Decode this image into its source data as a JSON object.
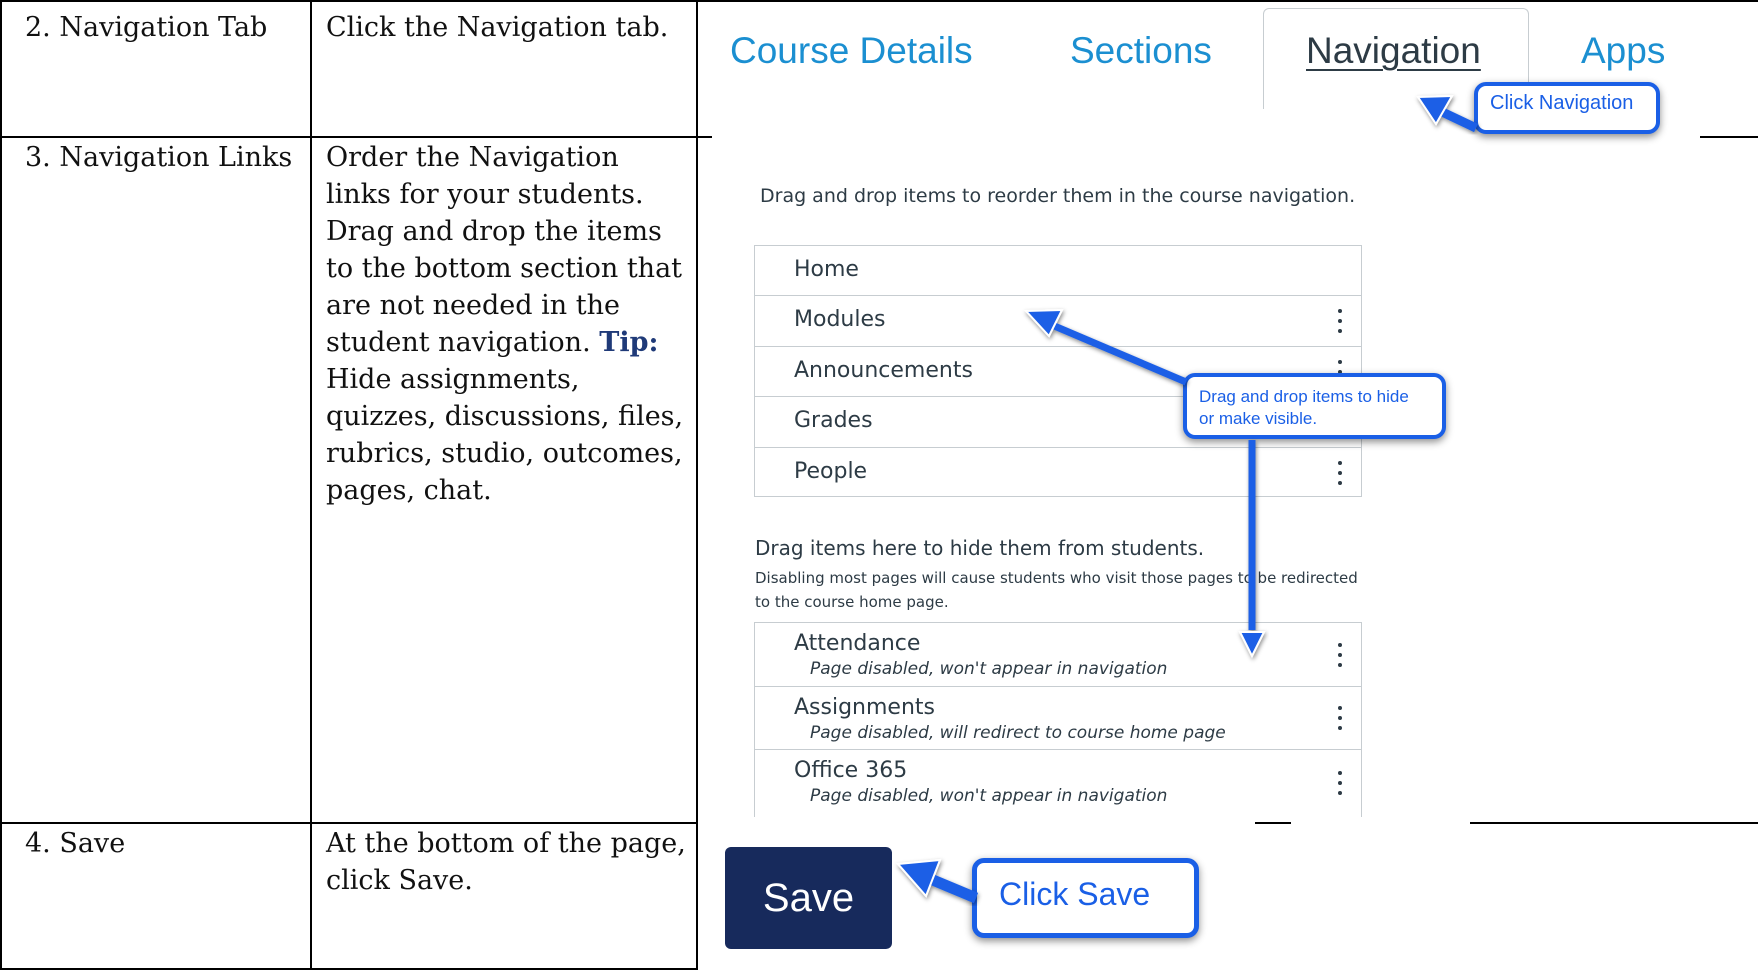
{
  "rows": [
    {
      "step": "2. Navigation Tab",
      "instruction": "Click the Navigation tab."
    },
    {
      "step": "3. Navigation Links",
      "instruction_lines": [
        "Order the Navigation",
        "links for your students.",
        "Drag and drop the items",
        "to the bottom section that",
        "are not needed in the",
        "student navigation. "
      ],
      "tip_label": "Tip:",
      "instruction_tail_lines": [
        "Hide assignments,",
        "quizzes, discussions, files,",
        "rubrics, studio, outcomes,",
        "pages, chat."
      ]
    },
    {
      "step": "4. Save",
      "instruction_lines": [
        "At the bottom of the page,",
        "click Save."
      ]
    }
  ],
  "tabs": [
    "Course Details",
    "Sections",
    "Navigation",
    "Apps"
  ],
  "active_tab": "Navigation",
  "callouts": {
    "navigation": "Click Navigation",
    "drag_line1": "Drag and drop items to hide",
    "drag_line2": "or make visible.",
    "save": "Click Save"
  },
  "navigation_page": {
    "instructions": "Drag and drop items to reorder them in the course navigation.",
    "enabled_items": [
      "Home",
      "Modules",
      "Announcements",
      "Grades",
      "People"
    ],
    "hidden_heading": "Drag items here to hide them from students.",
    "hidden_note_line1": "Disabling most pages will cause students who visit those pages to be redirected",
    "hidden_note_line2": "to the course home page.",
    "disabled_items": [
      {
        "label": "Attendance",
        "status": "Page disabled, won't appear in navigation"
      },
      {
        "label": "Assignments",
        "status": "Page disabled, will redirect to course home page"
      },
      {
        "label": "Office 365",
        "status": "Page disabled, won't appear in navigation"
      }
    ]
  },
  "save_button": "Save",
  "colors": {
    "link_blue": "#1b8fd1",
    "callout_blue": "#1a5fe6",
    "save_navy": "#172a5c",
    "tip_blue": "#1f3a78"
  }
}
